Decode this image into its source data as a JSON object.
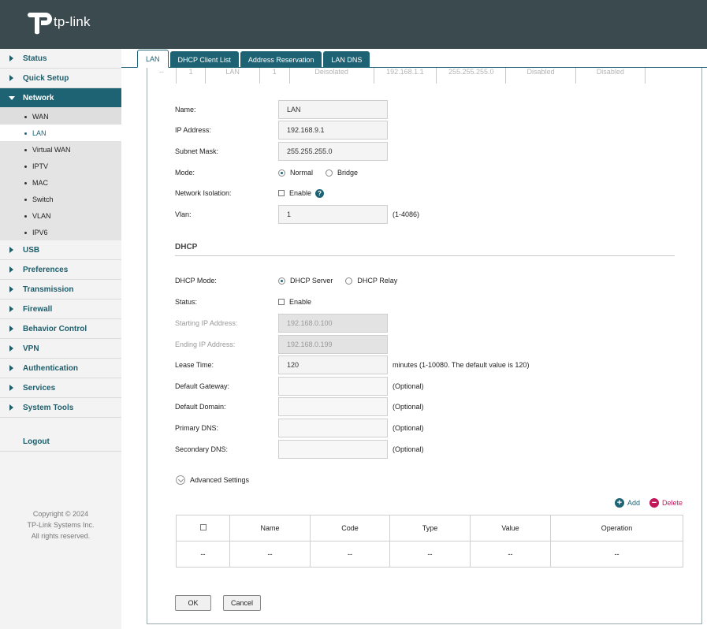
{
  "header": {
    "logo_text": "tp-link"
  },
  "sidebar": {
    "items": [
      {
        "label": "Status"
      },
      {
        "label": "Quick Setup"
      },
      {
        "label": "Network"
      },
      {
        "label": "USB"
      },
      {
        "label": "Preferences"
      },
      {
        "label": "Transmission"
      },
      {
        "label": "Firewall"
      },
      {
        "label": "Behavior Control"
      },
      {
        "label": "VPN"
      },
      {
        "label": "Authentication"
      },
      {
        "label": "Services"
      },
      {
        "label": "System Tools"
      }
    ],
    "network_sub": [
      "WAN",
      "LAN",
      "Virtual WAN",
      "IPTV",
      "MAC",
      "Switch",
      "VLAN",
      "IPV6"
    ],
    "logout": "Logout",
    "copyright": [
      "Copyright  © 2024",
      "TP-Link Systems Inc.",
      "All rights reserved."
    ]
  },
  "tabs": [
    "LAN",
    "DHCP Client List",
    "Address Reservation",
    "LAN DNS"
  ],
  "ghost_row": [
    "--",
    "1",
    "LAN",
    "1",
    "Deisolated",
    "192.168.1.1",
    "255.255.255.0",
    "Disabled",
    "Disabled"
  ],
  "lan": {
    "name_label": "Name:",
    "name_value": "LAN",
    "ip_label": "IP Address:",
    "ip_value": "192.168.9.1",
    "mask_label": "Subnet Mask:",
    "mask_value": "255.255.255.0",
    "mode_label": "Mode:",
    "mode_normal": "Normal",
    "mode_bridge": "Bridge",
    "isolation_label": "Network Isolation:",
    "isolation_enable": "Enable",
    "help": "?",
    "vlan_label": "Vlan:",
    "vlan_value": "1",
    "vlan_hint": "(1-4086)"
  },
  "dhcp": {
    "title": "DHCP",
    "mode_label": "DHCP Mode:",
    "mode_server": "DHCP Server",
    "mode_relay": "DHCP Relay",
    "status_label": "Status:",
    "status_enable": "Enable",
    "start_label": "Starting IP Address:",
    "start_value": "192.168.0.100",
    "end_label": "Ending IP Address:",
    "end_value": "192.168.0.199",
    "lease_label": "Lease Time:",
    "lease_value": "120",
    "lease_hint": "minutes (1-10080. The default value is 120)",
    "gateway_label": "Default Gateway:",
    "gateway_hint": "(Optional)",
    "domain_label": "Default Domain:",
    "domain_hint": "(Optional)",
    "pdns_label": "Primary DNS:",
    "pdns_hint": "(Optional)",
    "sdns_label": "Secondary DNS:",
    "sdns_hint": "(Optional)"
  },
  "advanced": {
    "label": "Advanced Settings",
    "add": "Add",
    "delete": "Delete"
  },
  "options_table": {
    "headers": [
      "Name",
      "Code",
      "Type",
      "Value",
      "Operation"
    ],
    "row": [
      "--",
      "--",
      "--",
      "--",
      "--",
      "--"
    ]
  },
  "buttons": {
    "ok": "OK",
    "cancel": "Cancel"
  },
  "colors": {
    "header_bg": "#3a4a4f",
    "accent": "#1e6374",
    "delete": "#c2185b"
  }
}
